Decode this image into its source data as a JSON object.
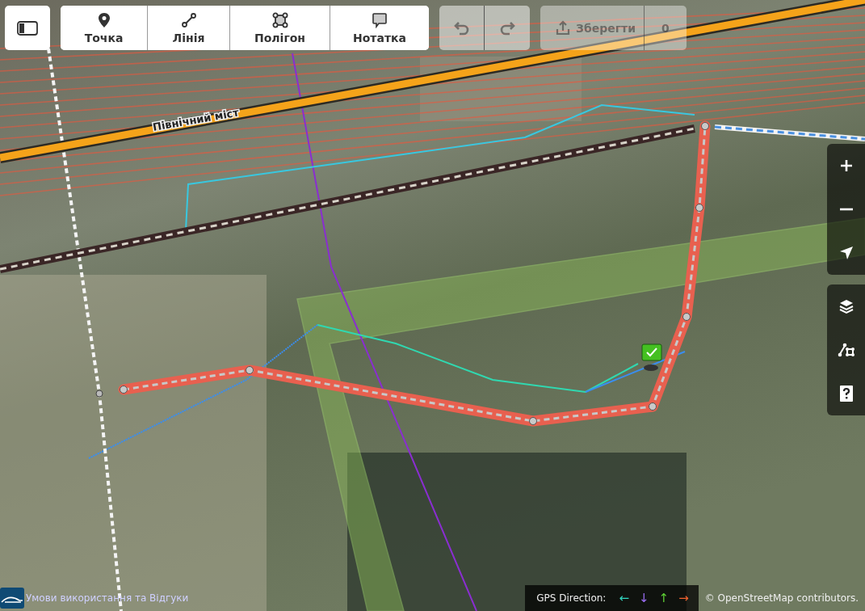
{
  "toolbar": {
    "modes": [
      {
        "label": "Точка"
      },
      {
        "label": "Лінія"
      },
      {
        "label": "Полігон"
      },
      {
        "label": "Нотатка"
      }
    ],
    "history": [
      {
        "disabled": true
      },
      {
        "disabled": true
      }
    ],
    "save": {
      "label": "Зберегти",
      "count": "0",
      "disabled": true
    }
  },
  "map": {
    "road_label": "Північний міст"
  },
  "footer": {
    "terms_link": "Умови використання та Відгуки",
    "gps_legend": {
      "label": "GPS Direction:",
      "arrows": [
        {
          "symbol": "←",
          "color": "#33d6c0"
        },
        {
          "symbol": "↓",
          "color": "#9b6ef3"
        },
        {
          "symbol": "↑",
          "color": "#5fd335"
        },
        {
          "symbol": "→",
          "color": "#f0622f"
        }
      ]
    },
    "attribution": "© OpenStreetMap contributors."
  }
}
